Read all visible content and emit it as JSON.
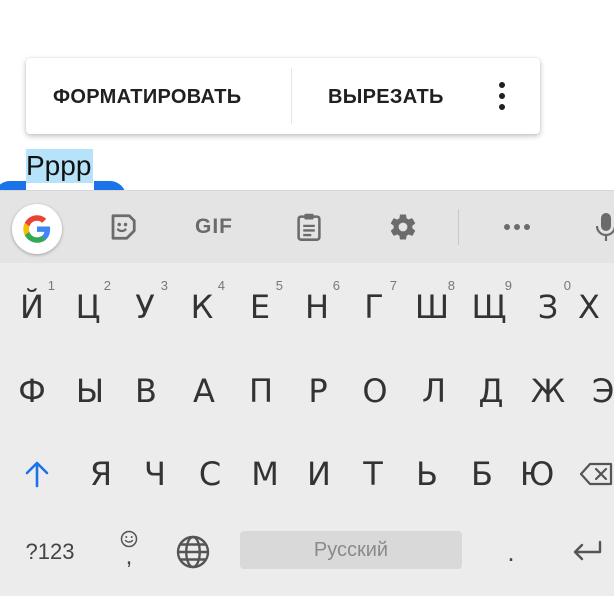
{
  "context_menu": {
    "format_label": "ФОРМАТИРОВАТЬ",
    "cut_label": "ВЫРЕЗАТЬ",
    "more_icon": "more-vert-icon"
  },
  "editor": {
    "selected_text": "Pppp"
  },
  "keyboard": {
    "toolbar": {
      "icons": [
        "google-g-icon",
        "sticker-icon",
        "clipboard-icon",
        "gear-icon",
        "more-horiz-icon",
        "mic-icon"
      ],
      "gif_label": "GIF"
    },
    "row1": [
      {
        "label": "Й",
        "hint": "1"
      },
      {
        "label": "Ц",
        "hint": "2"
      },
      {
        "label": "У",
        "hint": "3"
      },
      {
        "label": "К",
        "hint": "4"
      },
      {
        "label": "Е",
        "hint": "5"
      },
      {
        "label": "Н",
        "hint": "6"
      },
      {
        "label": "Г",
        "hint": "7"
      },
      {
        "label": "Ш",
        "hint": "8"
      },
      {
        "label": "Щ",
        "hint": "9"
      },
      {
        "label": "З",
        "hint": "0"
      },
      {
        "label": "Х",
        "hint": ""
      }
    ],
    "row2": [
      "Ф",
      "Ы",
      "В",
      "А",
      "П",
      "Р",
      "О",
      "Л",
      "Д",
      "Ж",
      "Э"
    ],
    "row3": [
      "Я",
      "Ч",
      "С",
      "М",
      "И",
      "Т",
      "Ь",
      "Б",
      "Ю"
    ],
    "row4": {
      "symbols_label": "?123",
      "emoji_comma": ",",
      "space_label": "Русский",
      "period": "."
    },
    "colors": {
      "accent": "#1a73e8",
      "shift_arrow": "#1a73e8",
      "selection_bg": "#b6e2fa"
    }
  }
}
